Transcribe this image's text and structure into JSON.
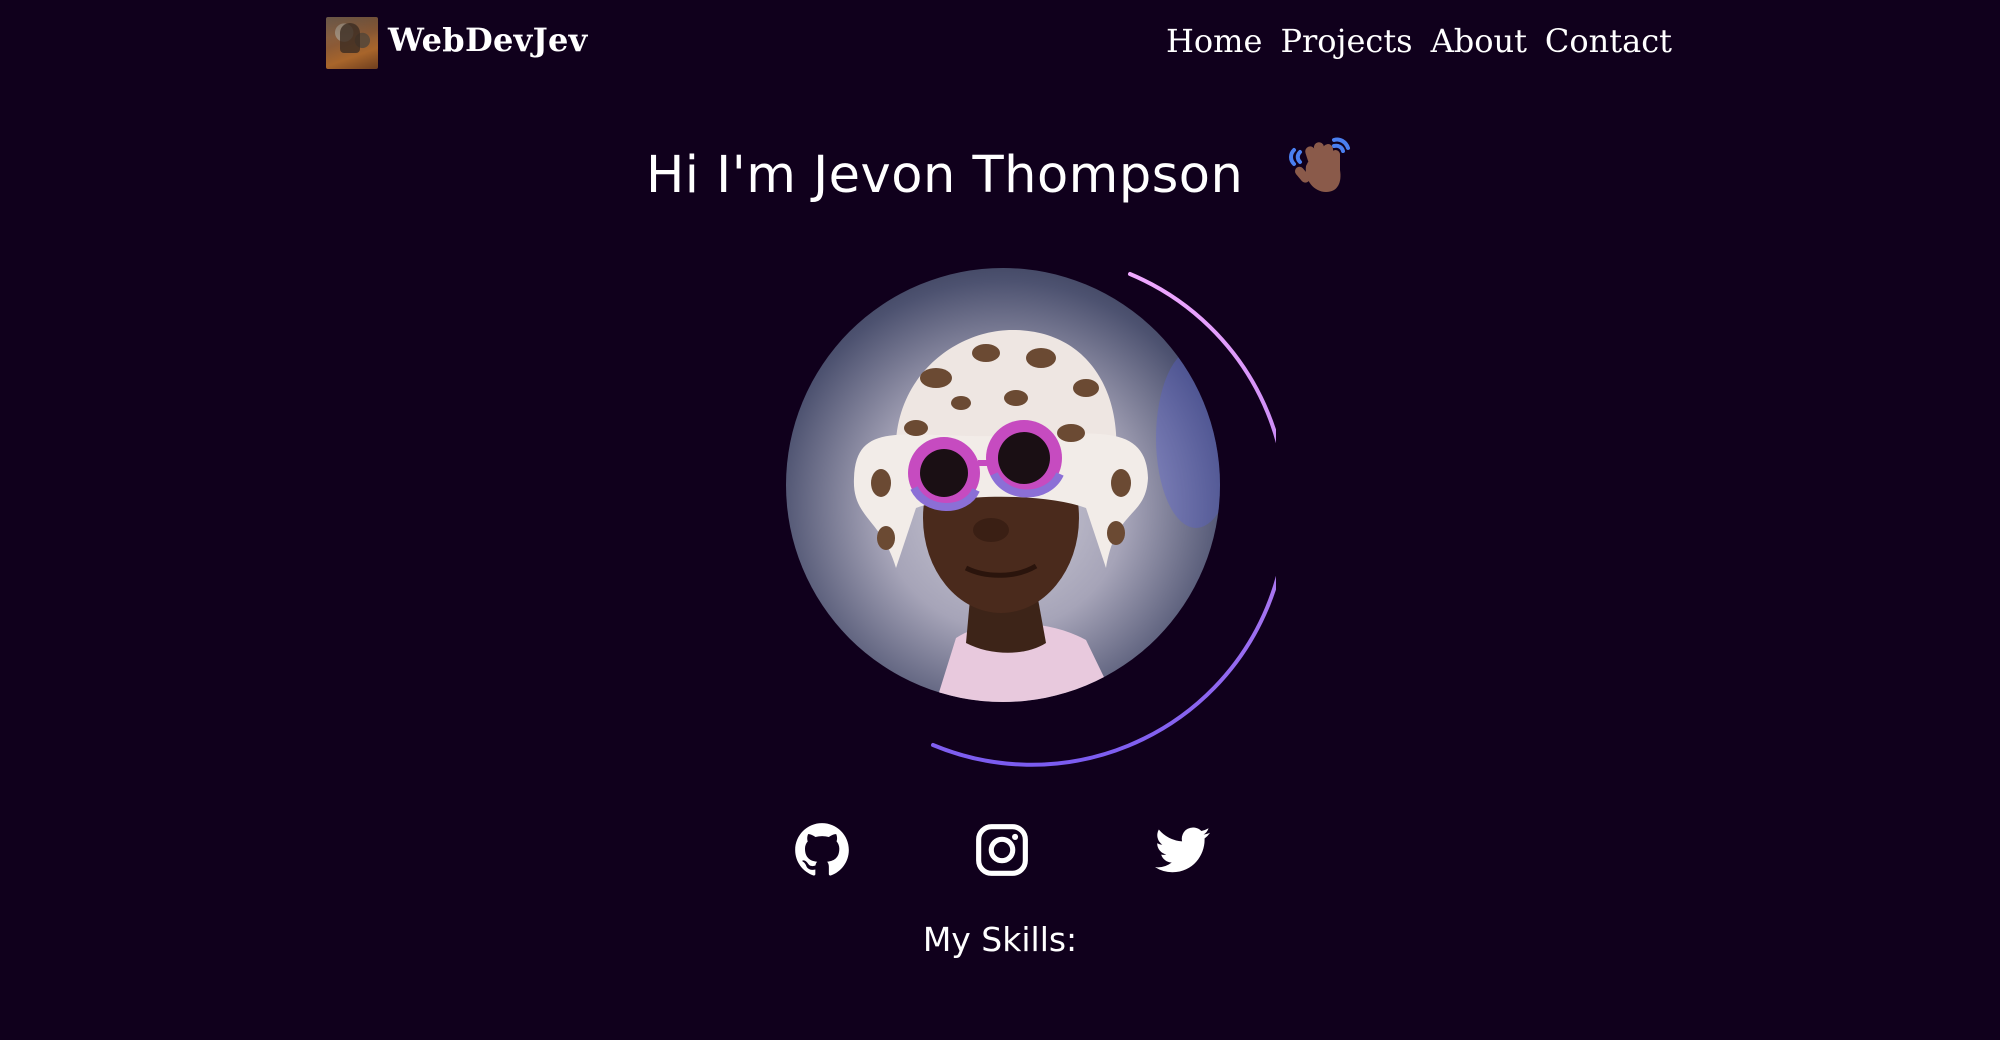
{
  "header": {
    "logo_text": "WebDevJev",
    "nav": [
      {
        "label": "Home"
      },
      {
        "label": "Projects"
      },
      {
        "label": "About"
      },
      {
        "label": "Contact"
      }
    ]
  },
  "hero": {
    "title": "Hi I'm Jevon Thompson",
    "wave_icon": "waving-hand-icon",
    "portrait_icon": "profile-photo",
    "accent_arc_colors": [
      "#f0a8ff",
      "#b47cf0",
      "#7b5cf0"
    ]
  },
  "socials": [
    {
      "icon": "github-icon"
    },
    {
      "icon": "instagram-icon"
    },
    {
      "icon": "twitter-icon"
    }
  ],
  "skills": {
    "title": "My Skills:"
  },
  "colors": {
    "background": "#10001c",
    "text": "#ffffff"
  }
}
